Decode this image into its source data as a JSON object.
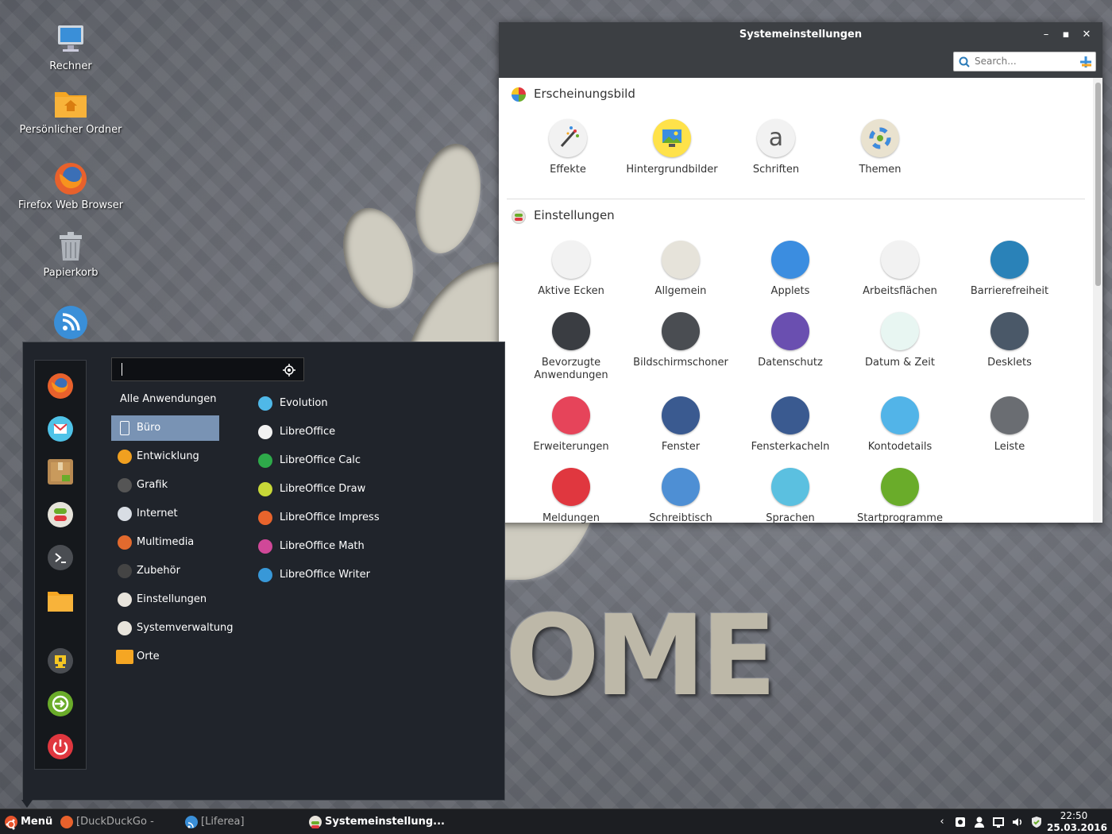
{
  "desktop": {
    "icons": [
      {
        "label": "Rechner",
        "icon": "computer-icon"
      },
      {
        "label": "Persönlicher Ordner",
        "icon": "home-folder-icon"
      },
      {
        "label": "Firefox Web Browser",
        "icon": "firefox-icon"
      },
      {
        "label": "Papierkorb",
        "icon": "trash-icon"
      },
      {
        "label": "",
        "icon": "rss-icon"
      }
    ],
    "wallpaper_text": "OME"
  },
  "window": {
    "title": "Systemeinstellungen",
    "search_placeholder": "Search...",
    "sections": [
      {
        "title": "Erscheinungsbild",
        "items": [
          {
            "label": "Effekte",
            "color": "#f2f2f2"
          },
          {
            "label": "Hintergrundbilder",
            "color": "#ffe24a"
          },
          {
            "label": "Schriften",
            "color": "#f2f2f2"
          },
          {
            "label": "Themen",
            "color": "#e9e2cf"
          }
        ]
      },
      {
        "title": "Einstellungen",
        "items": [
          {
            "label": "Aktive Ecken",
            "color": "#f2f2f2"
          },
          {
            "label": "Allgemein",
            "color": "#e6e3da"
          },
          {
            "label": "Applets",
            "color": "#3b8de0"
          },
          {
            "label": "Arbeitsflächen",
            "color": "#f2f2f2"
          },
          {
            "label": "Barrierefreiheit",
            "color": "#2a82b8"
          },
          {
            "label": "Bevorzugte\nAnwendungen",
            "color": "#3a3d42"
          },
          {
            "label": "Bildschirmschoner",
            "color": "#4a4d52"
          },
          {
            "label": "Datenschutz",
            "color": "#6a4fb0"
          },
          {
            "label": "Datum & Zeit",
            "color": "#e8f6f2"
          },
          {
            "label": "Desklets",
            "color": "#4a5868"
          },
          {
            "label": "Erweiterungen",
            "color": "#e6445a"
          },
          {
            "label": "Fenster",
            "color": "#3a5a90"
          },
          {
            "label": "Fensterkacheln",
            "color": "#3a5a90"
          },
          {
            "label": "Kontodetails",
            "color": "#52b4e8"
          },
          {
            "label": "Leiste",
            "color": "#6a6d72"
          },
          {
            "label": "Meldungen",
            "color": "#e0373f"
          },
          {
            "label": "Schreibtisch",
            "color": "#4e8fd4"
          },
          {
            "label": "Sprachen",
            "color": "#5bc0e0"
          },
          {
            "label": "Startprogramme",
            "color": "#6aac2a"
          }
        ]
      }
    ]
  },
  "menu": {
    "search_value": "",
    "categories": [
      {
        "label": "Alle Anwendungen",
        "color": ""
      },
      {
        "label": "Büro",
        "color": "#7993b4"
      },
      {
        "label": "Entwicklung",
        "color": "#f0a020"
      },
      {
        "label": "Grafik",
        "color": "#555"
      },
      {
        "label": "Internet",
        "color": "#d8dde4"
      },
      {
        "label": "Multimedia",
        "color": "#e26a2e"
      },
      {
        "label": "Zubehör",
        "color": "#444"
      },
      {
        "label": "Einstellungen",
        "color": "#e8e4dc"
      },
      {
        "label": "Systemverwaltung",
        "color": "#e8e4dc"
      },
      {
        "label": "Orte",
        "color": "#f5a623"
      }
    ],
    "apps": [
      {
        "label": "Evolution",
        "color": "#4fb8e8"
      },
      {
        "label": "LibreOffice",
        "color": "#f2f2f2"
      },
      {
        "label": "LibreOffice Calc",
        "color": "#2eaa4a"
      },
      {
        "label": "LibreOffice Draw",
        "color": "#c8d838"
      },
      {
        "label": "LibreOffice Impress",
        "color": "#e8642c"
      },
      {
        "label": "LibreOffice Math",
        "color": "#d04898"
      },
      {
        "label": "LibreOffice Writer",
        "color": "#3898d8"
      }
    ],
    "favorites": [
      {
        "icon": "firefox-icon",
        "color": "#e8612c"
      },
      {
        "icon": "mail-icon",
        "color": "#4fc3e8"
      },
      {
        "icon": "package-icon",
        "color": "#b88a52"
      },
      {
        "icon": "settings-toggle-icon",
        "color": "#e6e3da"
      },
      {
        "icon": "terminal-icon",
        "color": "#4a4d52"
      },
      {
        "icon": "folder-icon",
        "color": "#f5a623"
      },
      {
        "icon": "lock-screen-icon",
        "color": "#4a4d52"
      },
      {
        "icon": "logout-icon",
        "color": "#6aac2a"
      },
      {
        "icon": "power-icon",
        "color": "#e0373f"
      }
    ]
  },
  "taskbar": {
    "menu_label": "Menü",
    "tasks": [
      {
        "label": "[DuckDuckGo - Moz...",
        "icon": "firefox-icon"
      },
      {
        "label": "[Liferea]",
        "icon": "rss-icon"
      },
      {
        "label": "Systemeinstellung...",
        "icon": "settings-icon"
      }
    ],
    "time": "22:50",
    "date": "25.03.2016"
  }
}
